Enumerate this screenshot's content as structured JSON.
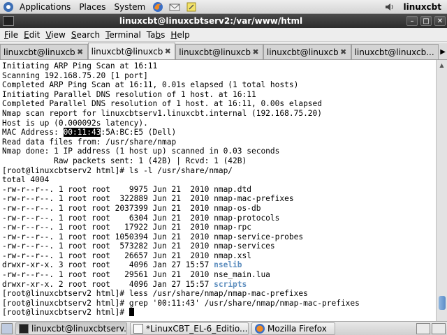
{
  "top_panel": {
    "menus": [
      "Applications",
      "Places",
      "System"
    ],
    "hostname": "linuxcbt",
    "launchers": [
      "firefox-icon",
      "mail-icon",
      "notes-icon"
    ],
    "tray": [
      "volume-icon"
    ]
  },
  "window": {
    "title": "linuxcbt@linuxcbtserv2:/var/www/html",
    "controls": [
      "minimize-icon",
      "maximize-icon",
      "close-icon"
    ]
  },
  "menubar": {
    "items": [
      {
        "pre": "",
        "u": "F",
        "post": "ile"
      },
      {
        "pre": "",
        "u": "E",
        "post": "dit"
      },
      {
        "pre": "",
        "u": "V",
        "post": "iew"
      },
      {
        "pre": "",
        "u": "S",
        "post": "earch"
      },
      {
        "pre": "",
        "u": "T",
        "post": "erminal"
      },
      {
        "pre": "Ta",
        "u": "b",
        "post": "s"
      },
      {
        "pre": "",
        "u": "H",
        "post": "elp"
      }
    ]
  },
  "tabs": [
    {
      "label": "linuxcbt@linuxcb...",
      "active": false
    },
    {
      "label": "linuxcbt@linuxcb...",
      "active": true
    },
    {
      "label": "linuxcbt@linuxcb...",
      "active": false
    },
    {
      "label": "linuxcbt@linuxcb...",
      "active": false
    },
    {
      "label": "linuxcbt@linuxcb...",
      "active": false
    }
  ],
  "terminal": {
    "lines": [
      "Initiating ARP Ping Scan at 16:11",
      "Scanning 192.168.75.20 [1 port]",
      "Completed ARP Ping Scan at 16:11, 0.01s elapsed (1 total hosts)",
      "Initiating Parallel DNS resolution of 1 host. at 16:11",
      "Completed Parallel DNS resolution of 1 host. at 16:11, 0.00s elapsed",
      "Nmap scan report for linuxcbtserv1.linuxcbt.internal (192.168.75.20)",
      "Host is up (0.000092s latency).",
      "MAC Address: 00:11:43:5A:BC:E5 (Dell)",
      "Read data files from: /usr/share/nmap",
      "Nmap done: 1 IP address (1 host up) scanned in 0.03 seconds",
      "           Raw packets sent: 1 (42B) | Rcvd: 1 (42B)",
      "[root@linuxcbtserv2 html]# ls -l /usr/share/nmap/",
      "total 4004",
      "-rw-r--r--. 1 root root    9975 Jun 21  2010 nmap.dtd",
      "-rw-r--r--. 1 root root  322889 Jun 21  2010 nmap-mac-prefixes",
      "-rw-r--r--. 1 root root 2037399 Jun 21  2010 nmap-os-db",
      "-rw-r--r--. 1 root root    6304 Jun 21  2010 nmap-protocols",
      "-rw-r--r--. 1 root root   17922 Jun 21  2010 nmap-rpc",
      "-rw-r--r--. 1 root root 1050394 Jun 21  2010 nmap-service-probes",
      "-rw-r--r--. 1 root root  573282 Jun 21  2010 nmap-services",
      "-rw-r--r--. 1 root root   26657 Jun 21  2010 nmap.xsl",
      "drwxr-xr-x. 3 root root    4096 Jan 27 15:57 nselib",
      "-rw-r--r--. 1 root root   29561 Jun 21  2010 nse_main.lua",
      "drwxr-xr-x. 2 root root    4096 Jan 27 15:57 scripts",
      "[root@linuxcbtserv2 html]# less /usr/share/nmap/nmap-mac-prefixes",
      "[root@linuxcbtserv2 html]# grep '00:11:43' /usr/share/nmap/nmap-mac-prefixes",
      "[root@linuxcbtserv2 html]# "
    ],
    "selected_text": "00:11:43",
    "directory_names": [
      "nselib",
      "scripts"
    ]
  },
  "taskbar": {
    "tasks": [
      {
        "label": "linuxcbt@linuxcbtserv...",
        "icon": "terminal-icon",
        "active": true
      },
      {
        "label": "*LinuxCBT_EL-6_Editio...",
        "icon": "text-editor-icon",
        "active": false
      },
      {
        "label": "Mozilla Firefox",
        "icon": "firefox-icon",
        "active": false
      }
    ]
  }
}
